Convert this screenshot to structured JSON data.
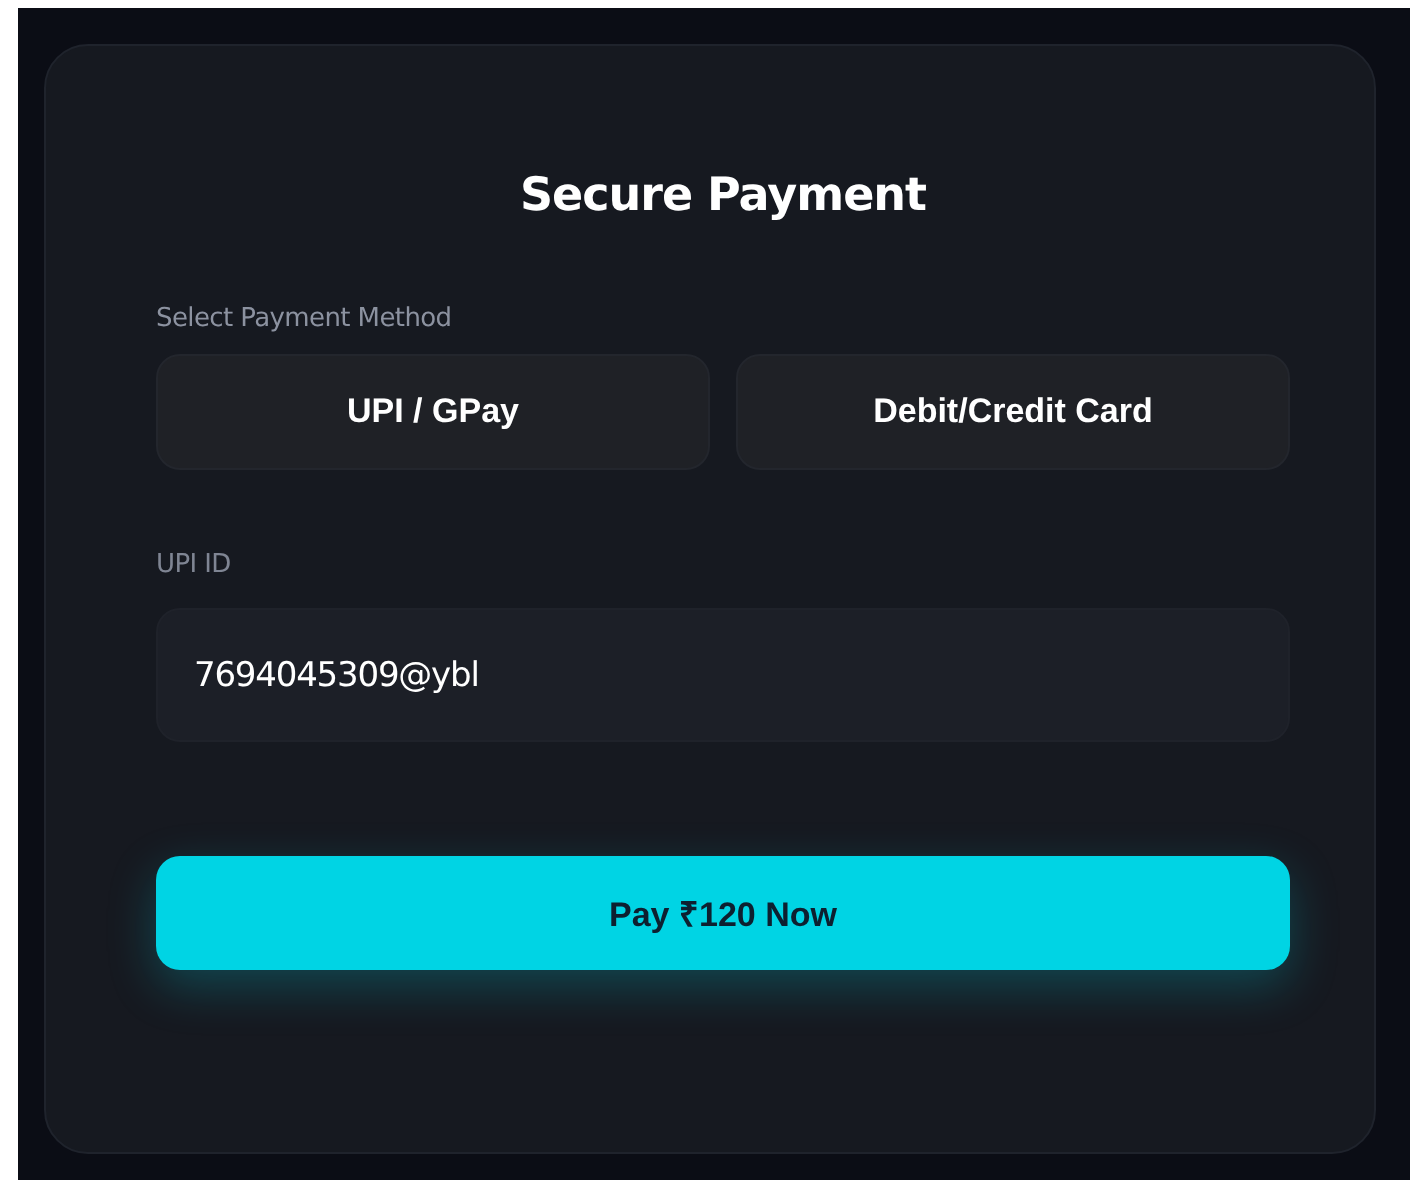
{
  "title": "Secure Payment",
  "method_label": "Select Payment Method",
  "methods": [
    {
      "label": "UPI / GPay",
      "selected": false
    },
    {
      "label": "Debit/Credit Card",
      "selected": false
    }
  ],
  "upi_field": {
    "label": "UPI ID",
    "value": "7694045309@ybl"
  },
  "pay_button": "Pay ₹120 Now"
}
